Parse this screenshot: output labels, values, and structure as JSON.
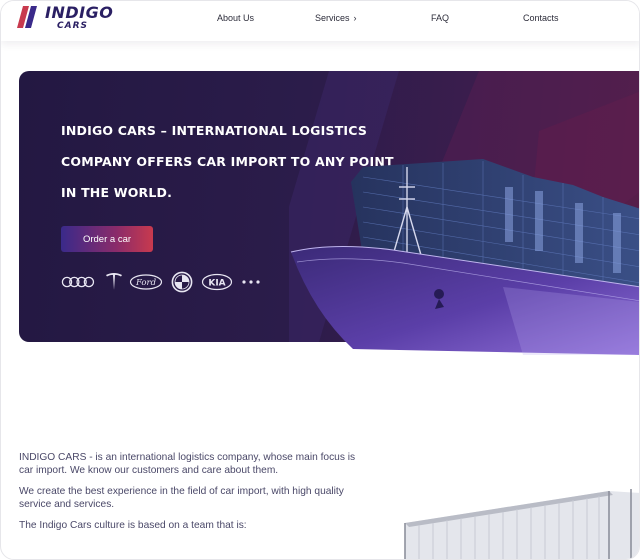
{
  "logo": {
    "brand": "INDIGO",
    "sub": "CARS"
  },
  "nav": [
    {
      "label": "About Us"
    },
    {
      "label": "Services",
      "icon": "chevron-right-icon"
    },
    {
      "label": "FAQ"
    },
    {
      "label": "Contacts"
    }
  ],
  "hero": {
    "headline": "INDIGO CARS – INTERNATIONAL LOGISTICS COMPANY OFFERS CAR IMPORT TO ANY POINT IN THE WORLD.",
    "cta": "Order a car",
    "brands": [
      "audi-logo",
      "tesla-logo",
      "ford-logo",
      "bmw-logo",
      "kia-logo",
      "more-icon"
    ],
    "ford_text": "Ford",
    "kia_text": "KIA"
  },
  "about": {
    "p1": "INDIGO CARS - is an international logistics company, whose main focus is car import. We know our customers and care about them.",
    "p2": "We create the best experience in the field of car import, with high quality service and services.",
    "p3": "The Indigo Cars culture is based on a team that is:"
  },
  "colors": {
    "brand": "#2a1f63",
    "accent_red": "#c83a4e",
    "hero_bg": "#231842"
  }
}
